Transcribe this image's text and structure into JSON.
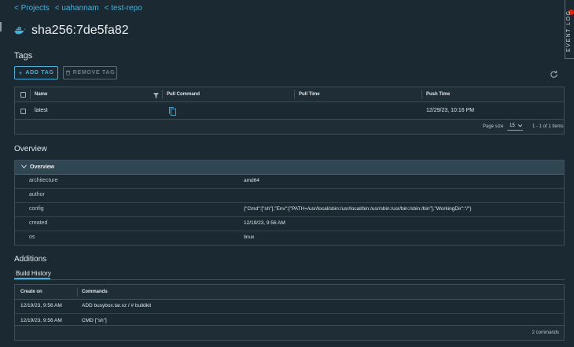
{
  "breadcrumb": [
    "< Projects",
    "< uahannam",
    "< test-repo"
  ],
  "page": {
    "title": "sha256:7de5fa82"
  },
  "event_log": {
    "label": "EVENT LOG"
  },
  "tags": {
    "section_title": "Tags",
    "add_label": "ADD TAG",
    "remove_label": "REMOVE TAG",
    "columns": [
      "Name",
      "Pull Command",
      "Pull Time",
      "Push Time"
    ],
    "rows": [
      {
        "name": "latest",
        "pull_time": "",
        "push_time": "12/29/23, 10:16 PM"
      }
    ],
    "footer": {
      "page_size_label": "Page size",
      "page_size": "15",
      "range": "1 - 1 of 1 items"
    }
  },
  "overview": {
    "section_title": "Overview",
    "header": "Overview",
    "rows": [
      {
        "key": "architecture",
        "value": "amd64"
      },
      {
        "key": "author",
        "value": ""
      },
      {
        "key": "config",
        "value": "{\"Cmd\":[\"sh\"],\"Env\":[\"PATH=/usr/local/sbin:/usr/local/bin:/usr/sbin:/usr/bin:/sbin:/bin\"],\"WorkingDir\":\"/\"}"
      },
      {
        "key": "created",
        "value": "12/19/23, 9:56 AM"
      },
      {
        "key": "os",
        "value": "linux"
      }
    ]
  },
  "additions": {
    "section_title": "Additions",
    "tab": "Build History",
    "columns": [
      "Create on",
      "Commands"
    ],
    "rows": [
      {
        "created": "12/19/23, 9:56 AM",
        "command": "ADD busybox.tar.xz / # buildkit"
      },
      {
        "created": "12/19/23, 9:56 AM",
        "command": "CMD [\"sh\"]"
      }
    ],
    "footer": "2 commands"
  },
  "colors": {
    "accent": "#49afd9",
    "background": "#1b2a32",
    "badge": "#e12200"
  }
}
